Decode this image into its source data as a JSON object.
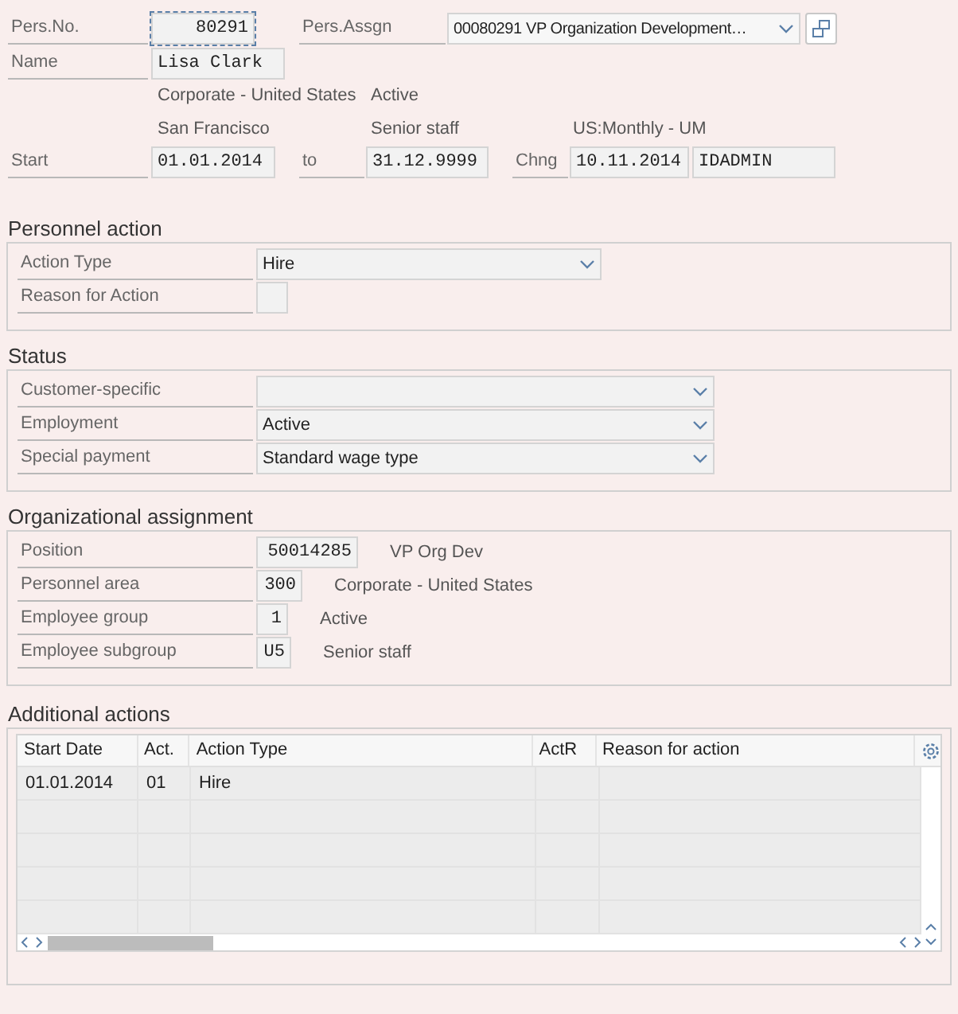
{
  "header": {
    "pers_no": {
      "label": "Pers.No.",
      "value": "80291",
      "focused": true
    },
    "pers_assgn": {
      "label": "Pers.Assgn",
      "value": "00080291 VP Organization Development…"
    },
    "name": {
      "label": "Name",
      "value": "Lisa Clark"
    },
    "info_lines": [
      [
        "Corporate - United States",
        "Active"
      ],
      [
        "San Francisco",
        "Senior staff",
        "US:Monthly - UM"
      ]
    ],
    "start": {
      "label": "Start",
      "value": "01.01.2014"
    },
    "to": {
      "label": "to",
      "value": "31.12.9999"
    },
    "chng": {
      "label": "Chng",
      "date": "10.11.2014",
      "user": "IDADMIN"
    }
  },
  "sections": [
    {
      "title": "Personnel action",
      "rows": [
        {
          "kind": "dropdown",
          "label": "Action Type",
          "value": "Hire"
        },
        {
          "kind": "input",
          "label": "Reason for Action",
          "value": ""
        }
      ]
    },
    {
      "title": "Status",
      "rows": [
        {
          "kind": "dropdown",
          "label": "Customer-specific",
          "value": ""
        },
        {
          "kind": "dropdown",
          "label": "Employment",
          "value": "Active"
        },
        {
          "kind": "dropdown",
          "label": "Special payment",
          "value": "Standard wage type"
        }
      ]
    },
    {
      "title": "Organizational assignment",
      "rows": [
        {
          "kind": "input",
          "label": "Position",
          "value": "50014285",
          "description": "VP Org Dev"
        },
        {
          "kind": "input",
          "label": "Personnel area",
          "value": "300",
          "description": "Corporate - United States"
        },
        {
          "kind": "input",
          "label": "Employee group",
          "value": "1",
          "description": "Active"
        },
        {
          "kind": "input",
          "label": "Employee subgroup",
          "value": "U5",
          "description": "Senior staff"
        }
      ]
    }
  ],
  "additional_actions": {
    "title": "Additional actions",
    "columns": [
      "Start Date",
      "Act.",
      "Action Type",
      "ActR",
      "Reason for action"
    ],
    "rows": [
      [
        "01.01.2014",
        "01",
        "Hire",
        "",
        ""
      ]
    ]
  }
}
